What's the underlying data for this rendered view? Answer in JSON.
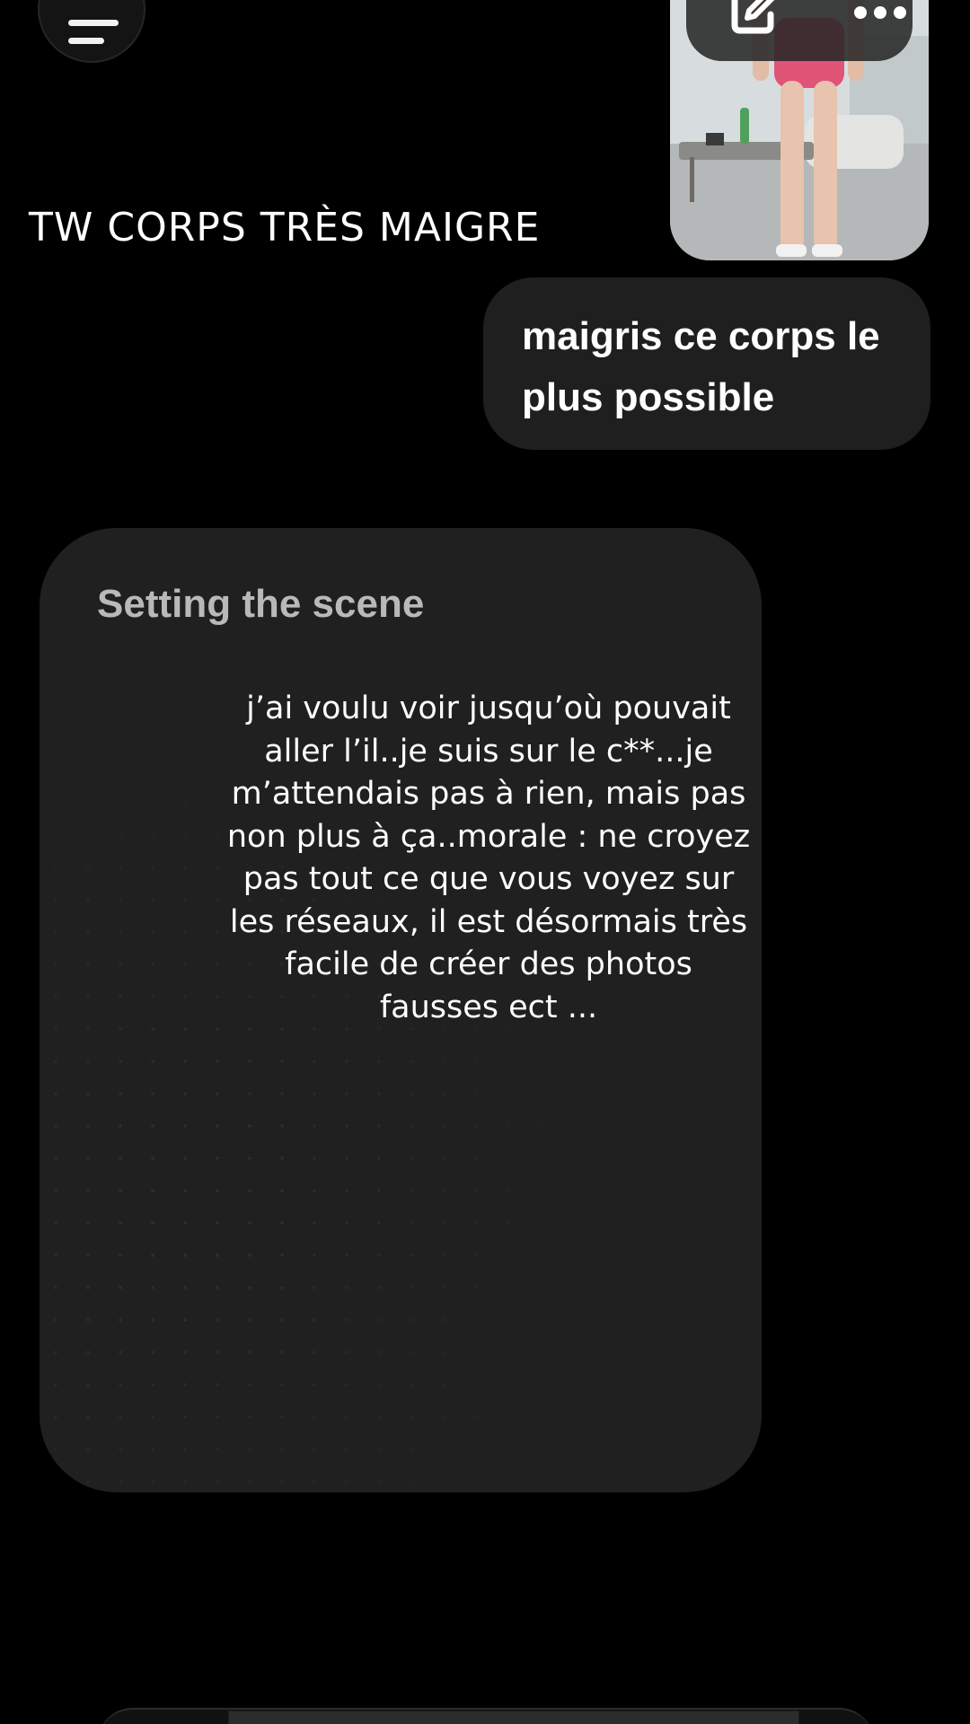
{
  "header": {
    "menu_icon": "menu-icon"
  },
  "attachment": {
    "toolbar": {
      "edit_icon": "edit-icon",
      "more_icon": "more-horizontal-icon"
    }
  },
  "caption": {
    "text": "TW CORPS TRÈS MAIGRE"
  },
  "user_message": {
    "line1": "maigris ce corps le",
    "line2": "plus possible"
  },
  "scene": {
    "title": "Setting the scene",
    "lines": [
      "j’ai voulu voir jusqu’où pouvait",
      "aller l’il..je suis sur le c**...je",
      "m’attendais pas à rien, mais pas",
      "non plus à ça..morale : ne croyez",
      "pas tout ce que vous voyez sur",
      "les réseaux, il est désormais très",
      "facile de créer des photos",
      "fausses ect ..."
    ]
  },
  "colors": {
    "background": "#000000",
    "bubble": "#1f1f1f",
    "card": "#202020",
    "title_gray": "#b9b9b9"
  }
}
